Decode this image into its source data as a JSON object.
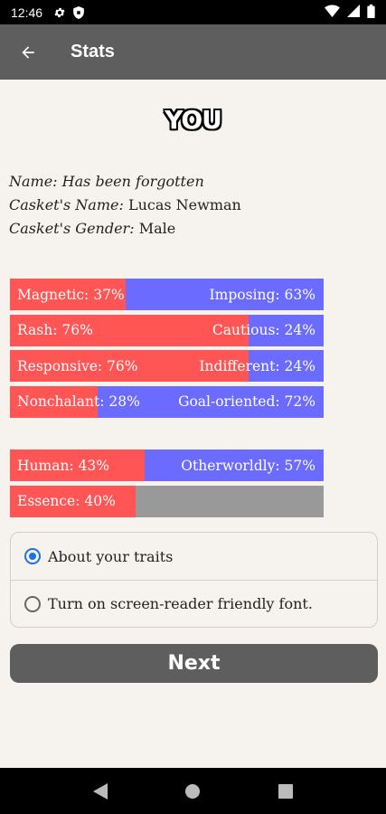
{
  "status_bar": {
    "time": "12:46",
    "icons": [
      "gear-icon",
      "shield-icon",
      "wifi-icon",
      "signal-icon",
      "battery-icon"
    ]
  },
  "app_bar": {
    "title": "Stats",
    "back_icon": "arrow-back-icon"
  },
  "heading": "YOU",
  "info": {
    "name_key": "Name:",
    "name_value": "Has been forgotten",
    "casket_name_key": "Casket's Name:",
    "casket_name_value": "Lucas Newman",
    "casket_gender_key": "Casket's Gender:",
    "casket_gender_value": "Male"
  },
  "trait_bars": [
    {
      "left_label": "Magnetic: 37%",
      "right_label": "Imposing: 63%",
      "left_value": 37,
      "left_color": "#ff5555",
      "right_color": "#6b6bff"
    },
    {
      "left_label": "Rash: 76%",
      "right_label": "Cautious: 24%",
      "left_value": 76,
      "left_color": "#ff5555",
      "right_color": "#6b6bff"
    },
    {
      "left_label": "Responsive: 76%",
      "right_label": "Indifferent: 24%",
      "left_value": 76,
      "left_color": "#ff5555",
      "right_color": "#6b6bff"
    },
    {
      "left_label": "Nonchalant: 28%",
      "right_label": "Goal-oriented: 72%",
      "left_value": 28,
      "left_color": "#ff5555",
      "right_color": "#6b6bff"
    }
  ],
  "nature_bars": [
    {
      "left_label": "Human: 43%",
      "right_label": "Otherworldly: 57%",
      "left_value": 43,
      "left_color": "#ff5555",
      "right_color": "#6b6bff"
    },
    {
      "left_label": "Essence: 40%",
      "right_label": "",
      "left_value": 40,
      "left_color": "#ff5555",
      "right_color": "#999999"
    }
  ],
  "options": [
    {
      "label": "About your traits",
      "selected": true
    },
    {
      "label": "Turn on screen-reader friendly font.",
      "selected": false
    }
  ],
  "next_label": "Next",
  "nav": {
    "back_icon": "nav-back-icon",
    "home_icon": "nav-home-icon",
    "recents_icon": "nav-recents-icon"
  }
}
